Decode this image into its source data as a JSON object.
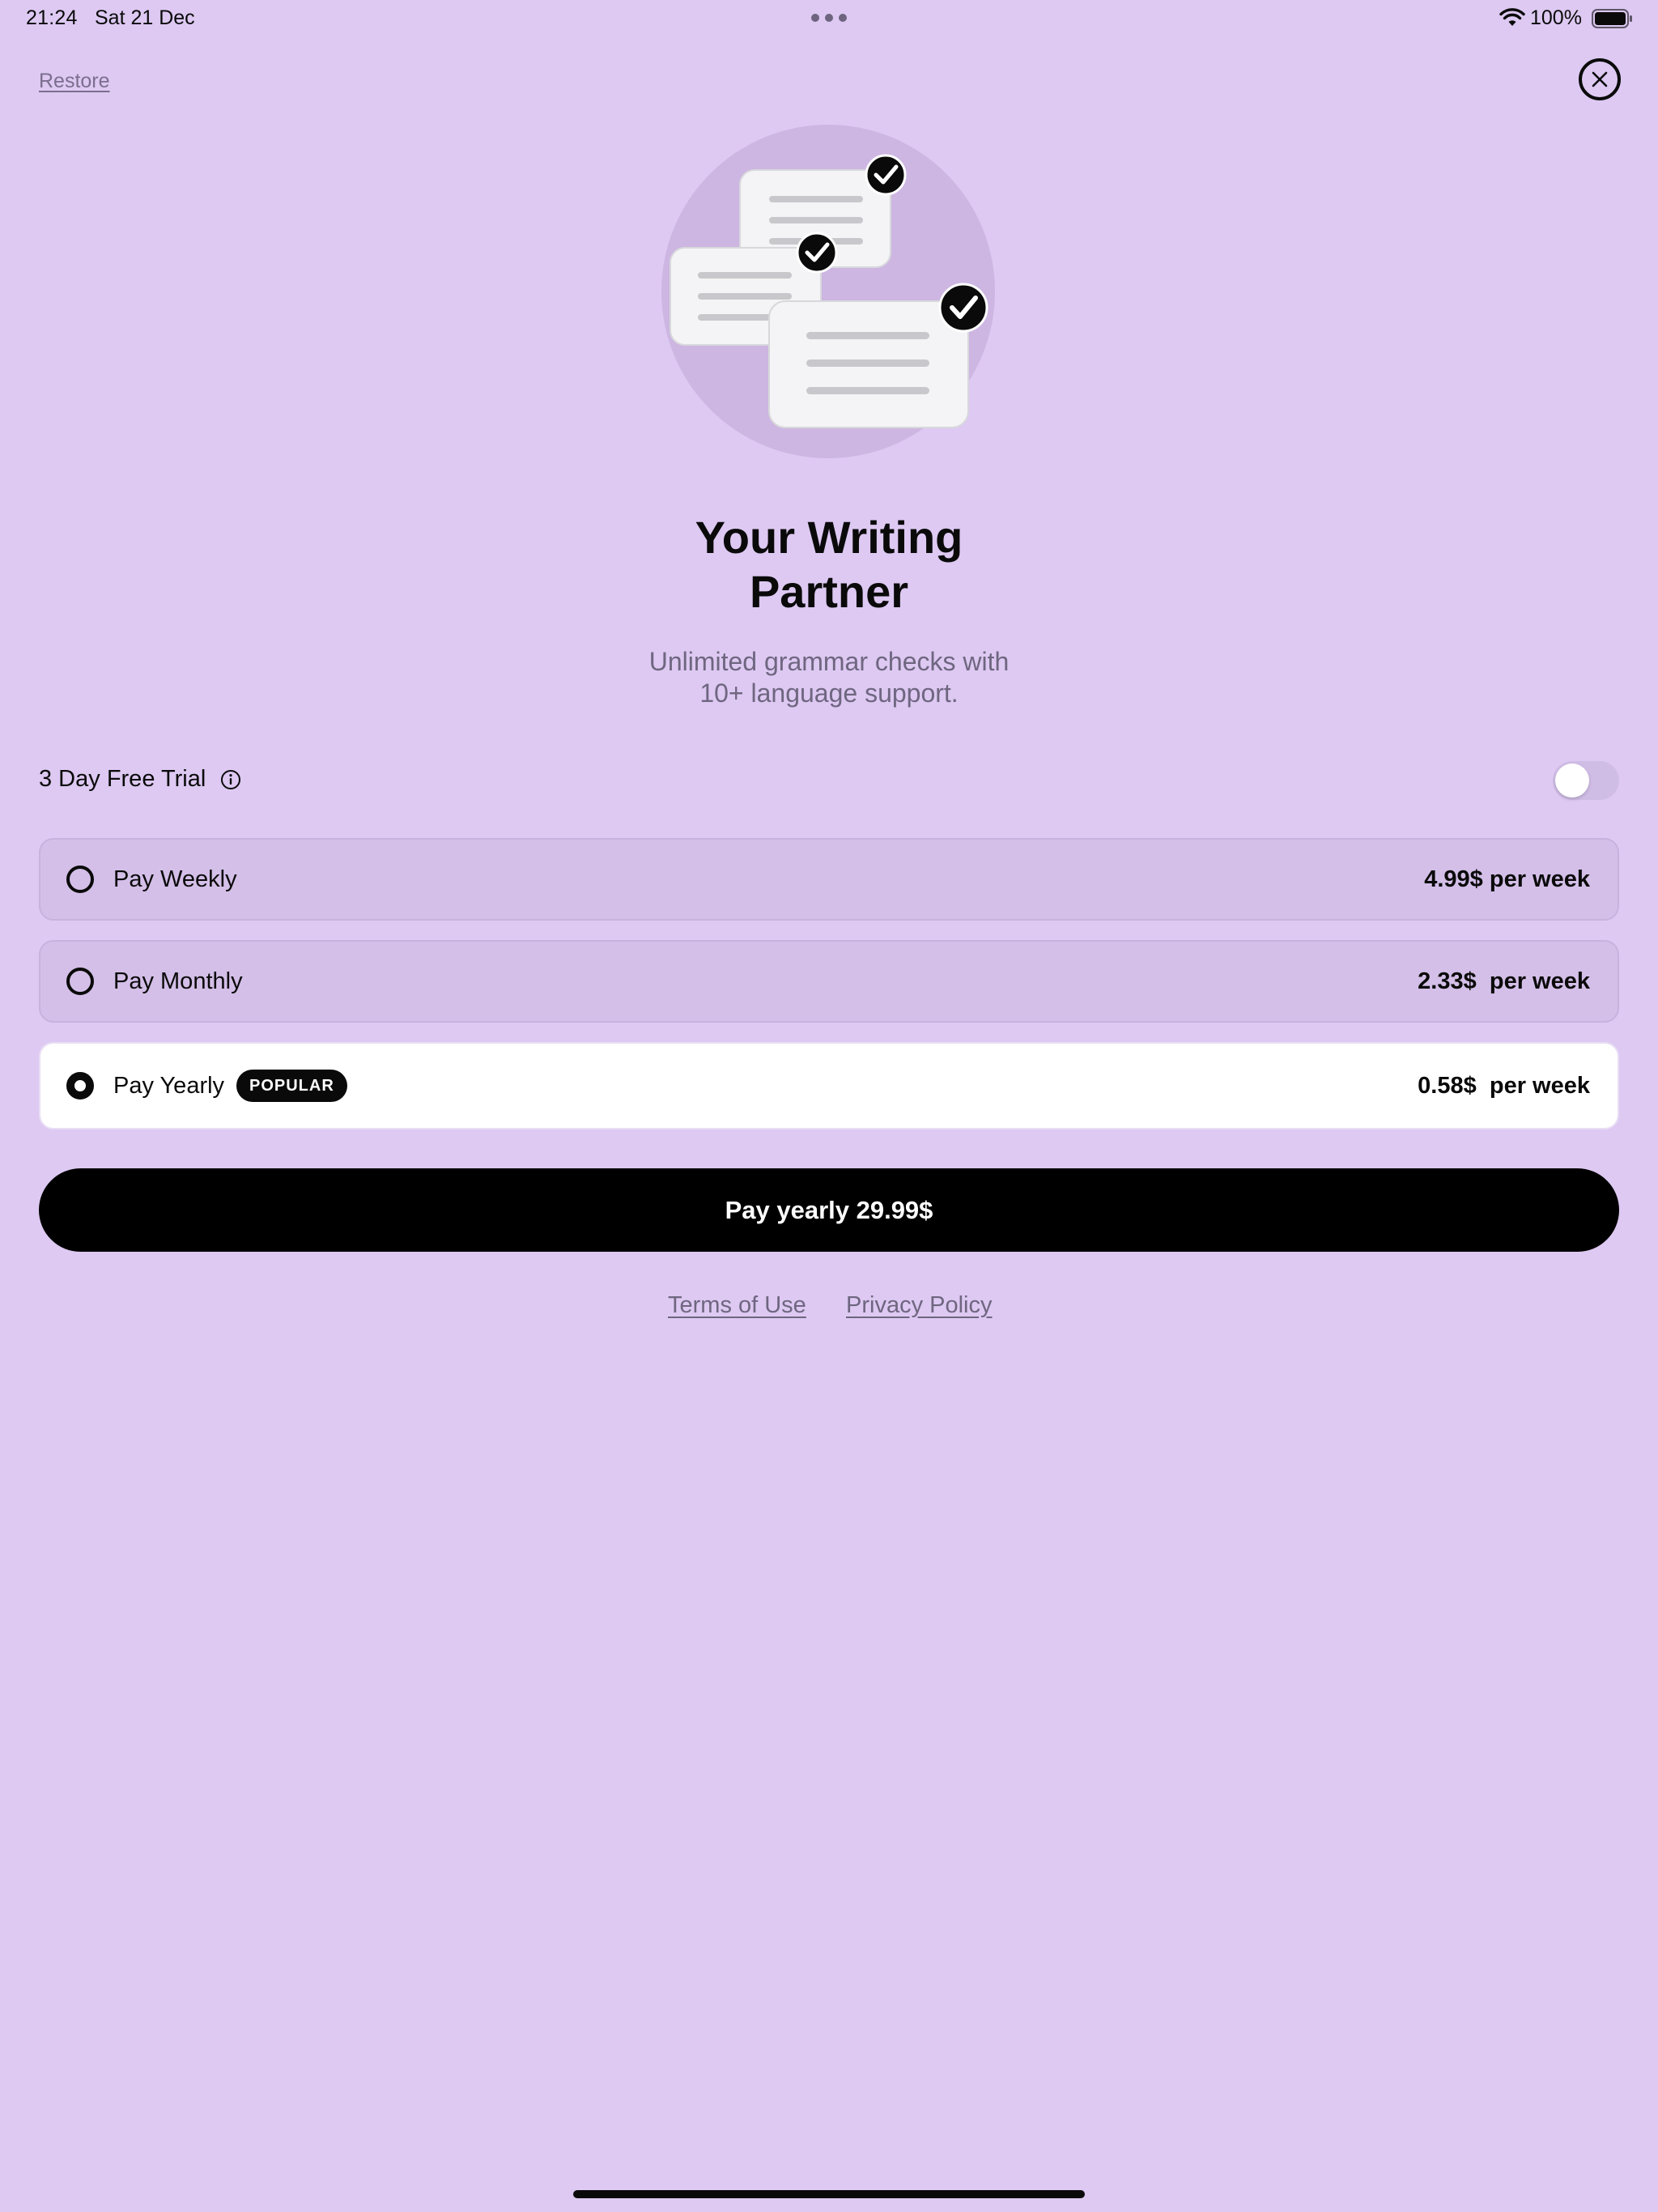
{
  "status_bar": {
    "time": "21:24",
    "date": "Sat 21 Dec",
    "battery_percent": "100%",
    "icons": [
      "multitask-dots-icon",
      "wifi-icon",
      "battery-icon"
    ]
  },
  "header": {
    "restore_label": "Restore",
    "close_icon": "close-icon"
  },
  "hero": {
    "illustration": "documents-checked-illustration"
  },
  "headline": {
    "title_line1": "Your Writing",
    "title_line2": "Partner",
    "subtitle_line1": "Unlimited grammar checks with",
    "subtitle_line2": "10+ language support."
  },
  "trial": {
    "label": "3 Day Free Trial",
    "info_icon": "info-icon",
    "enabled": false
  },
  "plans": [
    {
      "name": "Pay Weekly",
      "price": "4.99$ per week",
      "selected": false
    },
    {
      "name": "Pay Monthly",
      "price": "2.33$  per week",
      "selected": false
    },
    {
      "name": "Pay Yearly",
      "price": "0.58$  per week",
      "selected": true,
      "badge": "POPULAR"
    }
  ],
  "cta": {
    "label": "Pay yearly 29.99$"
  },
  "footer": {
    "terms_label": "Terms of Use",
    "privacy_label": "Privacy Policy"
  },
  "colors": {
    "background": "#ddc9f2",
    "plan_unselected": "#d4bfe8",
    "plan_selected": "#ffffff",
    "accent": "#000000",
    "muted_text": "#6f6680"
  }
}
